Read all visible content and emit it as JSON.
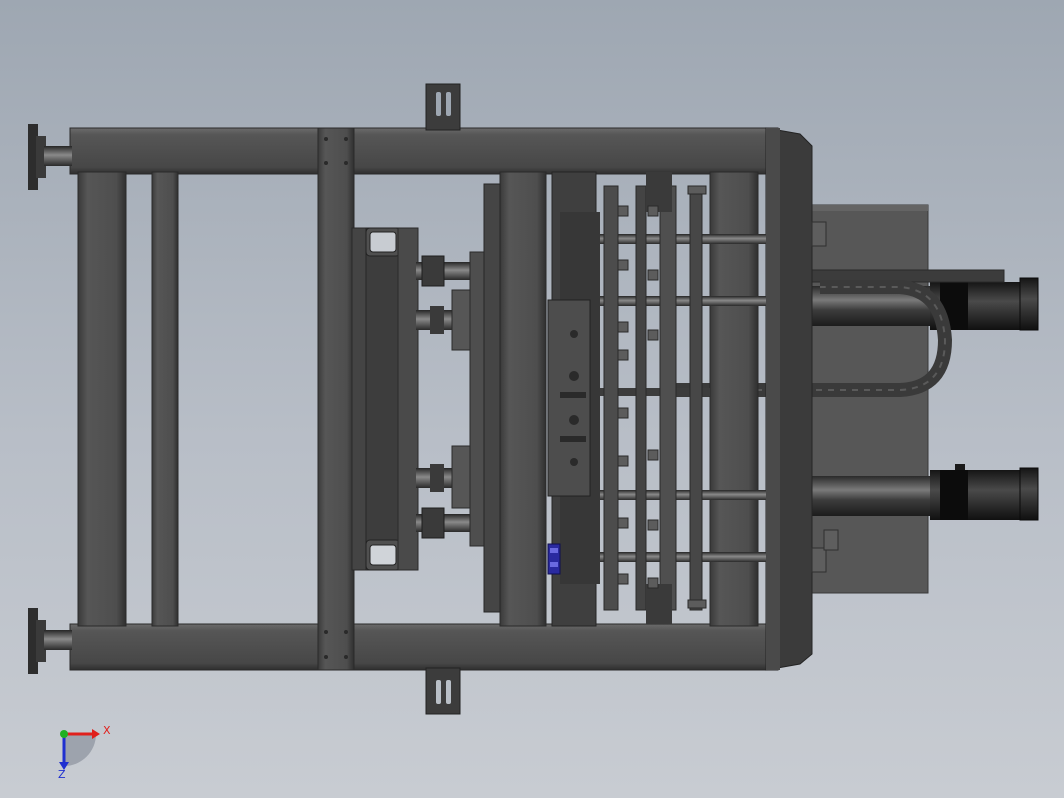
{
  "triad": {
    "x_label": "X",
    "z_label": "Z",
    "colors": {
      "x": "#e0201c",
      "y": "#20b020",
      "z": "#2030d0"
    }
  },
  "colors": {
    "background_top": "#9ea7b2",
    "background_bottom": "#c8ccd2",
    "steel": "#4b4b4b",
    "steel_dark": "#333333",
    "steel_light": "#6a6a6a",
    "panel": "#5a5a5a",
    "accent_blue": "#2a2aa0"
  }
}
